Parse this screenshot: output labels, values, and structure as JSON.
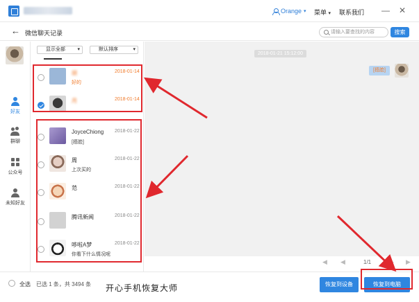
{
  "titlebar": {
    "username": "Orange",
    "menu_label": "菜单",
    "contact_label": "联系我们",
    "minimize_glyph": "—",
    "close_glyph": "✕"
  },
  "subheader": {
    "back_glyph": "←",
    "title": "微信聊天记录",
    "search_placeholder": "请输入要查找的内容",
    "search_button": "搜索"
  },
  "nav": {
    "items": [
      {
        "label": "好友",
        "active": true,
        "icon": "person-icon"
      },
      {
        "label": "群聊",
        "active": false,
        "icon": "group-icon"
      },
      {
        "label": "公众号",
        "active": false,
        "icon": "grid-icon"
      },
      {
        "label": "未知好友",
        "active": false,
        "icon": "unknown-person-icon"
      }
    ]
  },
  "list": {
    "filter_label": "显示全部",
    "sort_label": "默认排序",
    "contacts": [
      {
        "name": "胡",
        "date": "2018-01-14",
        "preview": "好的",
        "checked": false,
        "highlight": true,
        "avatar_color": "#9bb7d8"
      },
      {
        "name": "月",
        "date": "2018-01-14",
        "preview": "",
        "checked": true,
        "highlight": true,
        "avatar_color": "#4a4a4a"
      },
      {
        "name": "JoyceChiong",
        "date": "2018-01-22",
        "preview": "[捂脸]",
        "checked": false,
        "highlight": false,
        "avatar_color": "#8a7ab8"
      },
      {
        "name": "周",
        "date": "2018-01-22",
        "preview": "上次买的",
        "checked": false,
        "highlight": false,
        "avatar_color": "#d9c2b8"
      },
      {
        "name": "范",
        "date": "2018-01-22",
        "preview": "",
        "checked": false,
        "highlight": false,
        "avatar_color": "#f2c7a5"
      },
      {
        "name": "腾讯新闻",
        "date": "2018-01-22",
        "preview": "",
        "checked": false,
        "highlight": false,
        "avatar_color": "#cfcfcf"
      },
      {
        "name": "哆啦A梦",
        "date": "2018-01-22",
        "preview": "你看下什么情况呢",
        "checked": false,
        "highlight": false,
        "avatar_color": "#e8e8e8"
      }
    ]
  },
  "chat": {
    "timestamp": "2018-01-21 15:12:00",
    "message": "[捂脸]"
  },
  "pager": {
    "page_text": "1/1",
    "prev_glyph": "◀",
    "first_glyph": "◀",
    "next_glyph": "▶",
    "last_glyph": "▶"
  },
  "bottom": {
    "select_all": "全选",
    "selected_info": "已选 1 条，共 3494 条",
    "watermark": "开心手机恢复大师",
    "restore_device": "恢复到设备",
    "restore_computer": "恢复到电脑"
  },
  "colors": {
    "accent": "#2f86e0",
    "highlight_box": "#e0282e",
    "highlight_text": "#f07a2a"
  }
}
